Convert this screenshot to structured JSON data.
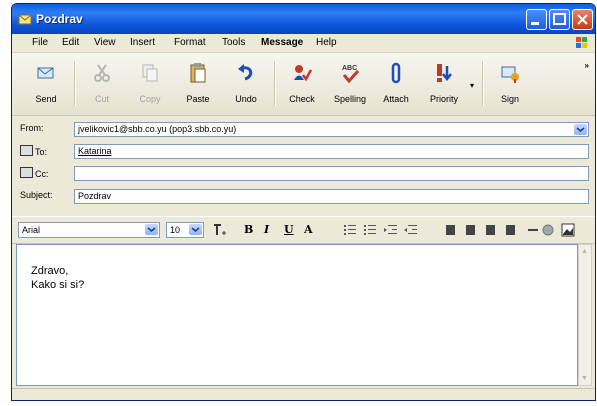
{
  "window": {
    "title": "Pozdrav"
  },
  "menu": {
    "items": [
      "File",
      "Edit",
      "View",
      "Insert",
      "Format",
      "Tools",
      "Message",
      "Help"
    ]
  },
  "toolbar": {
    "buttons": [
      {
        "label": "Send",
        "enabled": true
      },
      {
        "label": "Cut",
        "enabled": false
      },
      {
        "label": "Copy",
        "enabled": false
      },
      {
        "label": "Paste",
        "enabled": true
      },
      {
        "label": "Undo",
        "enabled": true
      },
      {
        "label": "Check",
        "enabled": true
      },
      {
        "label": "Spelling",
        "enabled": true
      },
      {
        "label": "Attach",
        "enabled": true
      },
      {
        "label": "Priority",
        "enabled": true
      },
      {
        "label": "Sign",
        "enabled": true
      }
    ],
    "overflow": "»"
  },
  "headers": {
    "from_label": "From:",
    "from_value": "jvelikovic1@sbb.co.yu   (pop3.sbb.co.yu)",
    "to_label": "To:",
    "to_value": "Katarina",
    "cc_label": "Cc:",
    "cc_value": "",
    "subject_label": "Subject:",
    "subject_value": "Pozdrav"
  },
  "format": {
    "font": "Arial",
    "size": "10"
  },
  "body": {
    "lines": [
      "Zdravo,",
      "Kako si si?"
    ]
  }
}
